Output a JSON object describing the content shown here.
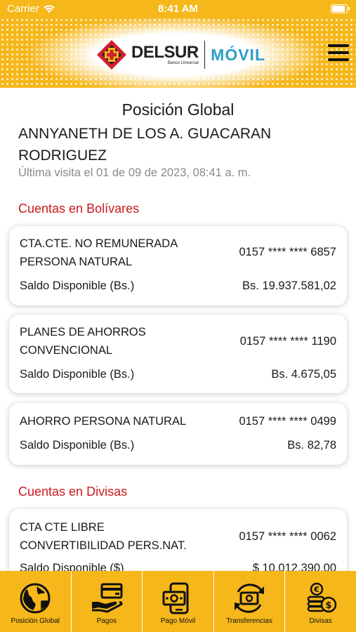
{
  "status_bar": {
    "carrier": "Carrier",
    "time": "8:41 AM",
    "battery_level": 1.0
  },
  "header": {
    "brand_name": "DELSUR",
    "brand_subtitle": "Banco Universal",
    "app_name": "MÓVIL",
    "menu_icon": "hamburger-menu-icon"
  },
  "main": {
    "title": "Posición Global",
    "user_name": "ANNYANETH DE LOS A. GUACARAN RODRIGUEZ",
    "last_visit": "Última visita el 01 de 09 de 2023, 08:41 a. m."
  },
  "sections": {
    "bolivares": {
      "title": "Cuentas en Bolívares",
      "accounts": [
        {
          "type": "CTA.CTE. NO REMUNERADA PERSONA NATURAL",
          "number": "0157 **** **** 6857",
          "balance_label": "Saldo Disponible (Bs.)",
          "balance": "Bs. 19.937.581,02"
        },
        {
          "type": "PLANES DE AHORROS CONVENCIONAL",
          "number": "0157 **** **** 1190",
          "balance_label": "Saldo Disponible (Bs.)",
          "balance": "Bs. 4.675,05"
        },
        {
          "type": "AHORRO PERSONA NATURAL",
          "number": "0157 **** **** 0499",
          "balance_label": "Saldo Disponible (Bs.)",
          "balance": "Bs. 82,78"
        }
      ]
    },
    "divisas": {
      "title": "Cuentas en Divisas",
      "accounts": [
        {
          "type": "CTA CTE LIBRE CONVERTIBILIDAD PERS.NAT.",
          "number": "0157 **** **** 0062",
          "balance_label": "Saldo Disponible ($)",
          "balance": "$ 10.012.390,00"
        }
      ]
    }
  },
  "tabbar": {
    "items": [
      {
        "label": "Posición Global",
        "icon": "globe-icon"
      },
      {
        "label": "Pagos",
        "icon": "card-hand-icon"
      },
      {
        "label": "Pago Móvil",
        "icon": "mobile-payment-icon"
      },
      {
        "label": "Transferencias",
        "icon": "transfer-icon"
      },
      {
        "label": "Divisas",
        "icon": "coins-icon"
      }
    ]
  },
  "colors": {
    "brand_yellow": "#f6b71b",
    "section_red": "#c8191e",
    "movil_blue": "#2e9ec7",
    "logo_red": "#d0202e"
  }
}
